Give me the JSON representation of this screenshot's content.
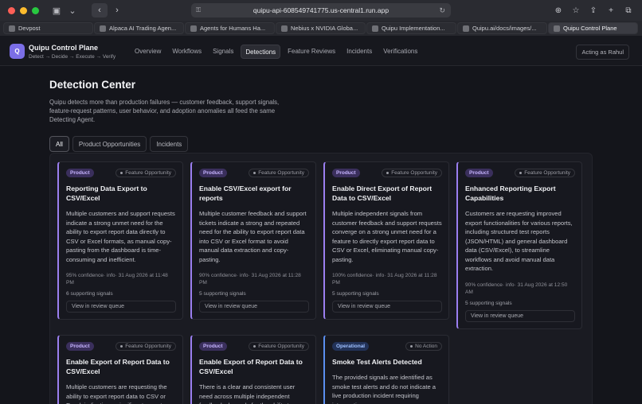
{
  "browser": {
    "url": "quipu-api-608549741775.us-central1.run.app",
    "tabs": [
      {
        "label": "Devpost"
      },
      {
        "label": "Alpaca AI Trading Agen..."
      },
      {
        "label": "Agents for Humans Ha..."
      },
      {
        "label": "Nebius x NVIDIA Globa..."
      },
      {
        "label": "Quipu Implementation..."
      },
      {
        "label": "Quipu.ai/docs/images/..."
      },
      {
        "label": "Quipu Control Plane"
      }
    ]
  },
  "header": {
    "logo_letter": "Q",
    "brand": "Quipu Control Plane",
    "tagline": "Detect → Decide → Execute → Verify",
    "nav": [
      "Overview",
      "Workflows",
      "Signals",
      "Detections",
      "Feature Reviews",
      "Incidents",
      "Verifications"
    ],
    "acting_as": "Acting as Rahul"
  },
  "main": {
    "title": "Detection Center",
    "description": "Quipu detects more than production failures — customer feedback, support signals, feature-request patterns, user behavior, and adoption anomalies all feed the same Detecting Agent.",
    "filters": [
      "All",
      "Product Opportunities",
      "Incidents"
    ]
  },
  "cards": [
    {
      "badge": "Product",
      "type": "Feature Opportunity",
      "title": "Reporting Data Export to CSV/Excel",
      "body": "Multiple customers and support requests indicate a strong unmet need for the ability to export report data directly to CSV or Excel formats, as manual copy-pasting from the dashboard is time-consuming and inefficient.",
      "meta": "95% confidence· info· 31 Aug 2026 at 11:48 PM",
      "signals": "6 supporting signals",
      "queue": "View in review queue"
    },
    {
      "badge": "Product",
      "type": "Feature Opportunity",
      "title": "Enable CSV/Excel export for reports",
      "body": "Multiple customer feedback and support tickets indicate a strong and repeated need for the ability to export report data into CSV or Excel format to avoid manual data extraction and copy-pasting.",
      "meta": "90% confidence· info· 31 Aug 2026 at 11:28 PM",
      "signals": "5 supporting signals",
      "queue": "View in review queue"
    },
    {
      "badge": "Product",
      "type": "Feature Opportunity",
      "title": "Enable Direct Export of Report Data to CSV/Excel",
      "body": "Multiple independent signals from customer feedback and support requests converge on a strong unmet need for a feature to directly export report data to CSV or Excel, eliminating manual copy-pasting.",
      "meta": "100% confidence· info· 31 Aug 2026 at 11:28 PM",
      "signals": "5 supporting signals",
      "queue": "View in review queue"
    },
    {
      "badge": "Product",
      "type": "Feature Opportunity",
      "title": "Enhanced Reporting Export Capabilities",
      "body": "Customers are requesting improved export functionalities for various reports, including structured test reports (JSON/HTML) and general dashboard data (CSV/Excel), to streamline workflows and avoid manual data extraction.",
      "meta": "90% confidence· info· 31 Aug 2026 at 12:50 AM",
      "signals": "5 supporting signals",
      "queue": "View in review queue"
    },
    {
      "badge": "Product",
      "type": "Feature Opportunity",
      "title": "Enable Export of Report Data to CSV/Excel",
      "body": "Multiple customers are requesting the ability to export report data to CSV or Excel, indicating a significant unmet need."
    },
    {
      "badge": "Product",
      "type": "Feature Opportunity",
      "title": "Enable Export of Report Data to CSV/Excel",
      "body": "There is a clear and consistent user need across multiple independent feedback channels for the ability to export report data."
    },
    {
      "badge": "Operational",
      "type": "No Action",
      "title": "Smoke Test Alerts Detected",
      "body": "The provided signals are identified as smoke test alerts and do not indicate a live production incident requiring intervention."
    }
  ]
}
